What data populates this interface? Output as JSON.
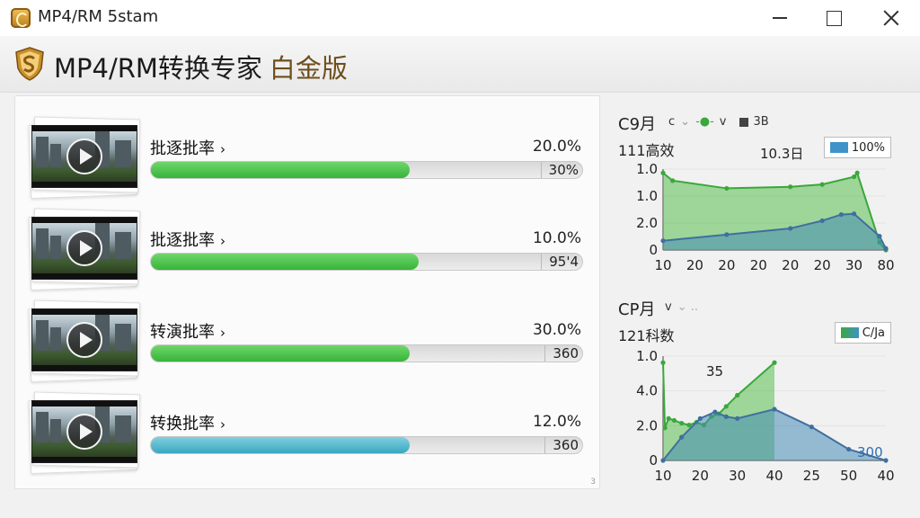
{
  "window": {
    "title": "MP4/RM 5stam",
    "min_icon": "minimize-icon",
    "max_icon": "maximize-icon",
    "close_icon": "close-icon"
  },
  "header": {
    "app_name": "MP4/RM转换专家",
    "edition": "白金版",
    "logo_icon": "shield-logo-icon"
  },
  "panel": {
    "scroll_mark": "3"
  },
  "rows": [
    {
      "label": "批逐批率",
      "percent": "20.0%",
      "progress": 0.6,
      "bar_end": "30%",
      "color": "#3fba40"
    },
    {
      "label": "批逐批率",
      "percent": "10.0%",
      "progress": 0.62,
      "bar_end": "95'4",
      "color": "#3fba40"
    },
    {
      "label": "转演批率",
      "percent": "30.0%",
      "progress": 0.6,
      "bar_end": "360",
      "color": "#3fba40"
    },
    {
      "label": "转换批率",
      "percent": "12.0%",
      "progress": 0.6,
      "bar_end": "360",
      "color": "#3fa9c4"
    }
  ],
  "row_play_icon": "play-icon",
  "row_chevron": "›",
  "chart_data": [
    {
      "type": "area",
      "title": "C9月",
      "subtitle": "111高效",
      "legend_inline": [
        "c",
        "v",
        "3B"
      ],
      "legend_box": "100%",
      "annotation": "10.3日",
      "x_ticks": [
        "10",
        "20",
        "20",
        "20",
        "20",
        "20",
        "30",
        "80"
      ],
      "y_ticks": [
        "1.0",
        "1.0",
        "2.0",
        "0"
      ],
      "colors": {
        "green": "#3aa83a",
        "blue": "#3f6fa0"
      },
      "series": [
        {
          "x": [
            0,
            0.3,
            2,
            4,
            5,
            6,
            6.1,
            6.8,
            7
          ],
          "y": [
            1.0,
            0.9,
            0.8,
            0.82,
            0.85,
            0.95,
            1.0,
            0.1,
            0
          ]
        },
        {
          "x": [
            0,
            2,
            4,
            5,
            5.6,
            6,
            6.8,
            7
          ],
          "y": [
            0.12,
            0.2,
            0.28,
            0.38,
            0.46,
            0.47,
            0.18,
            0.02
          ]
        }
      ],
      "xlim": [
        0,
        7
      ],
      "ylim": [
        0,
        1.05
      ]
    },
    {
      "type": "area",
      "title": "CP月",
      "subtitle": "121科数",
      "legend_inline": [
        "v"
      ],
      "legend_box": "C/Ja",
      "annotations": [
        "35",
        "300"
      ],
      "x_ticks": [
        "10",
        "20",
        "30",
        "40",
        "25",
        "50",
        "40"
      ],
      "y_ticks": [
        "1.0",
        "4.0",
        "2.0",
        "0"
      ],
      "colors": {
        "green": "#3aa83a",
        "blue": "#3f6fa0"
      },
      "series": [
        {
          "x": [
            0,
            0.05,
            0.15,
            0.3,
            0.5,
            0.7,
            0.9,
            1.1,
            1.3,
            1.5,
            1.7,
            2.0,
            3.0
          ],
          "y": [
            1.05,
            0.35,
            0.45,
            0.43,
            0.4,
            0.38,
            0.41,
            0.38,
            0.47,
            0.5,
            0.58,
            0.7,
            1.05
          ]
        },
        {
          "x": [
            0,
            0.5,
            1.0,
            1.4,
            1.7,
            2.0,
            3.0,
            4.0,
            5.0,
            6.0
          ],
          "y": [
            0.0,
            0.25,
            0.45,
            0.52,
            0.47,
            0.45,
            0.55,
            0.36,
            0.12,
            0.0
          ]
        }
      ],
      "xlim": [
        0,
        6
      ],
      "ylim": [
        0,
        1.12
      ]
    }
  ]
}
